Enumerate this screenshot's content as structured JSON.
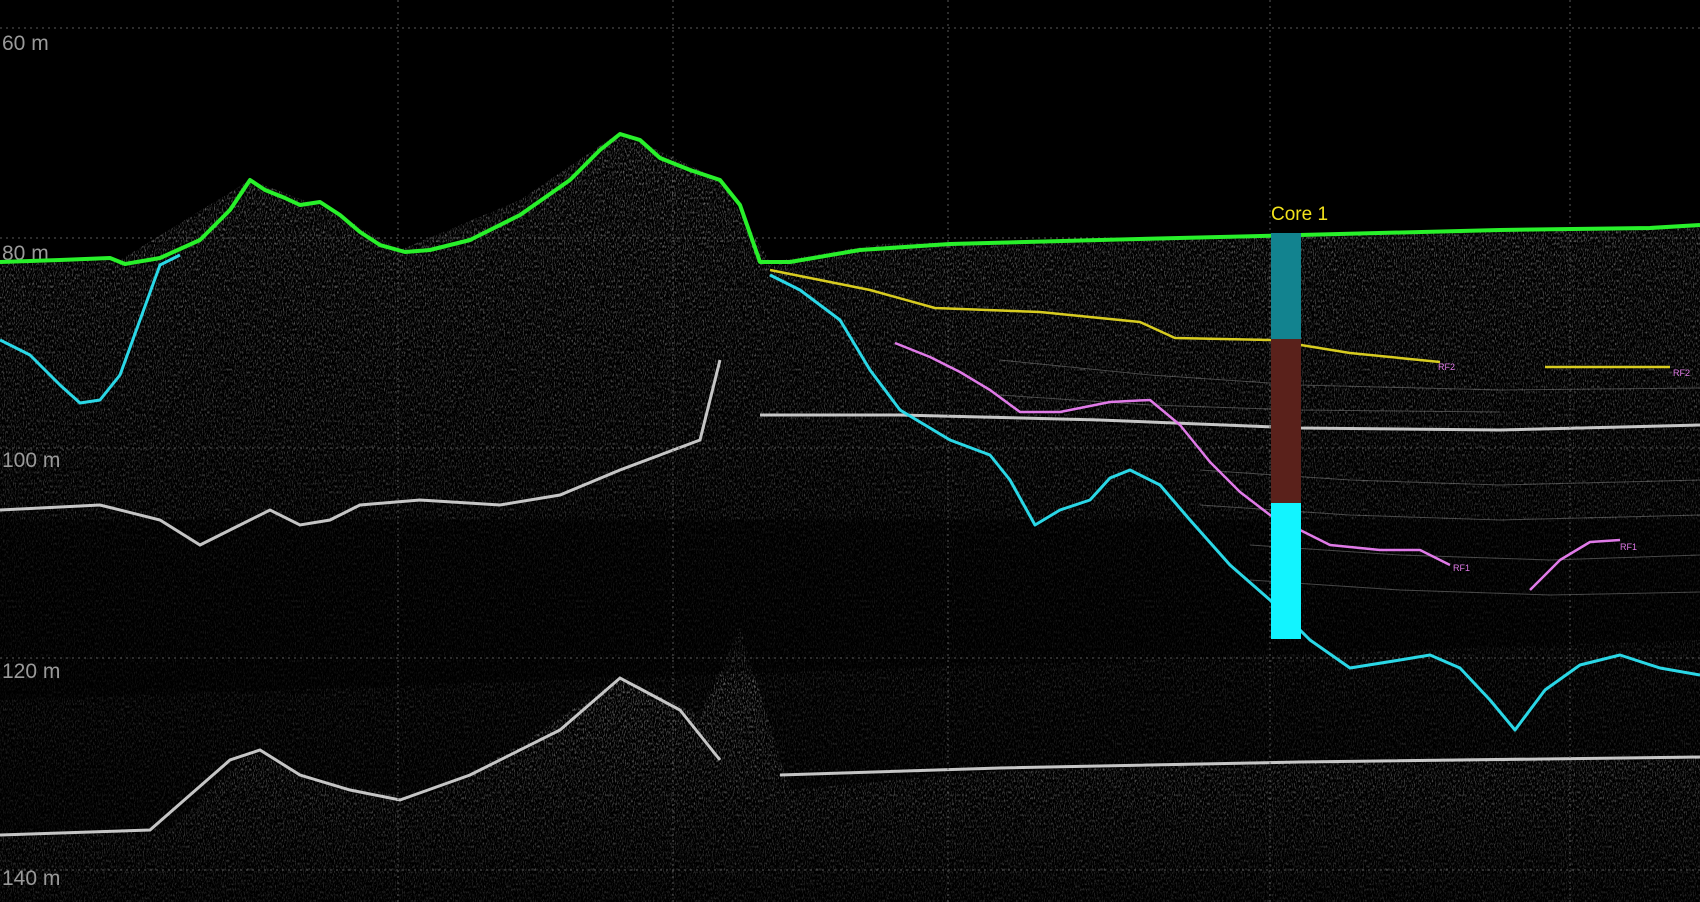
{
  "depth_axis": {
    "unit": "m",
    "labels": [
      "60 m",
      "80 m",
      "100 m",
      "120 m",
      "140 m"
    ]
  },
  "core": {
    "label": "Core 1",
    "segment_colors": [
      "#12838f",
      "#5a211b",
      "#12f4ff"
    ]
  },
  "horizons": [
    {
      "name": "seafloor",
      "color": "#28f02a"
    },
    {
      "name": "acoustic-basement",
      "color": "#2ad7e6"
    },
    {
      "name": "reflector-upper",
      "color": "#d8cc20",
      "tag": "RF2"
    },
    {
      "name": "reflector-lower",
      "color": "#e07ae8",
      "tag": "RF1"
    }
  ],
  "colors": {
    "background": "#000000",
    "echo": "#d8d8d8",
    "grid": "#5a5a5a"
  }
}
